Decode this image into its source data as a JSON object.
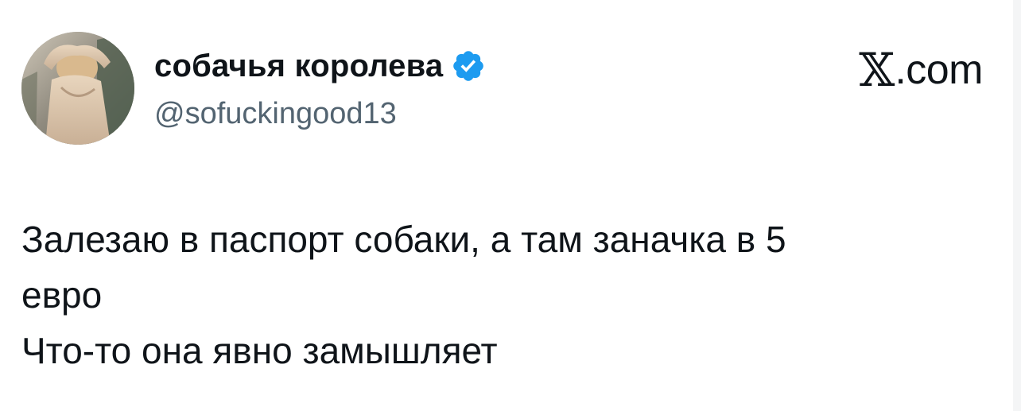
{
  "tweet": {
    "author": {
      "display_name": "собачья королева",
      "handle": "@sofuckingood13",
      "verified": true,
      "avatar_icon": "profile-photo"
    },
    "brand": {
      "logo_letter": "𝕏",
      "domain": ".com"
    },
    "text_lines": [
      "Залезаю в паспорт собаки, а там заначка в 5",
      "евро",
      "Что-то она явно замышляет"
    ]
  },
  "colors": {
    "text_primary": "#0f1419",
    "text_secondary": "#536471",
    "verified_badge": "#1d9bf0",
    "background": "#ffffff"
  }
}
